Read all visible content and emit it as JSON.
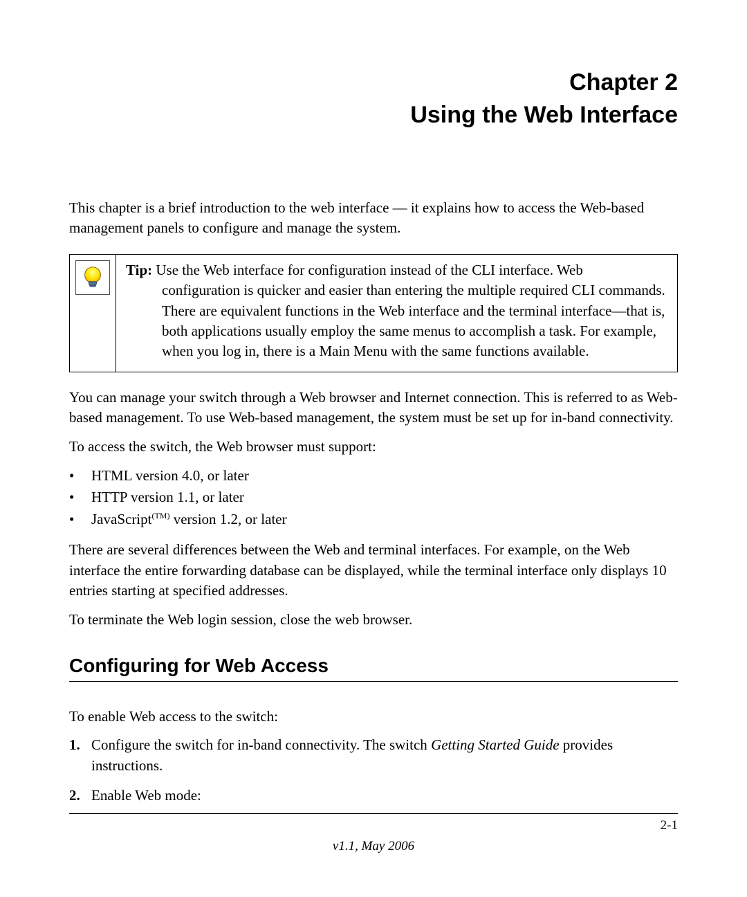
{
  "header": {
    "chapter_number": "Chapter 2",
    "chapter_title": "Using the Web Interface"
  },
  "intro": "This chapter is a brief introduction to the web interface — it explains how to access the Web-based management panels to configure and manage the system.",
  "tip": {
    "label": "Tip:",
    "first_line": " Use the Web interface for configuration instead of the CLI interface. Web",
    "continuation": "configuration is quicker and easier than entering the multiple required CLI commands. There are equivalent functions in the Web interface and the terminal interface—that is, both applications usually employ the same menus to accomplish a task. For example, when you log in, there is a Main Menu with the same functions available."
  },
  "para_web_management": "You can manage your switch through a Web browser and Internet connection. This is referred to as Web-based management. To use Web-based management, the system must be set up for in-band connectivity.",
  "para_browser_support": "To access the switch, the Web browser must support:",
  "browser_requirements": [
    "HTML version 4.0, or later",
    "HTTP version 1.1, or later"
  ],
  "js_req_prefix": "JavaScript",
  "js_req_tm": "(TM)",
  "js_req_suffix": " version 1.2, or later",
  "para_differences": "There are several differences between the Web and terminal interfaces. For example, on the Web interface the entire forwarding database can be displayed, while the terminal interface only displays 10 entries starting at specified addresses.",
  "para_terminate": "To terminate the Web login session, close the web browser.",
  "section_heading": "Configuring for Web Access",
  "para_enable": "To enable Web access to the switch:",
  "steps": {
    "step1_prefix": "Configure the switch for in-band connectivity. The switch ",
    "step1_italic": "Getting Started Guide",
    "step1_suffix": " provides instructions.",
    "step2": "Enable Web mode:"
  },
  "footer": {
    "page_number": "2-1",
    "version": "v1.1, May 2006"
  }
}
